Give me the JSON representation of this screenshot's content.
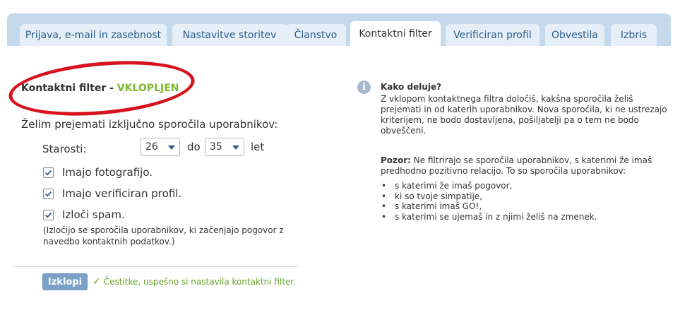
{
  "tabs": [
    {
      "label": "Prijava, e-mail in zasebnost",
      "active": false
    },
    {
      "label": "Nastavitve storitev",
      "active": false
    },
    {
      "label": "Članstvo",
      "active": false
    },
    {
      "label": "Kontaktni filter",
      "active": true
    },
    {
      "label": "Verificiran profil",
      "active": false
    },
    {
      "label": "Obvestila",
      "active": false
    },
    {
      "label": "Izbris",
      "active": false
    }
  ],
  "filter": {
    "title": "Kontaktni filter - ",
    "state": "VKLOPLJEN",
    "intro": "Želim prejemati izključno sporočila uporabnikov:",
    "age_label": "Starosti:",
    "age_from": "26",
    "age_separator": "do",
    "age_to": "35",
    "age_unit": "let",
    "options": [
      {
        "label": "Imajo fotografijo.",
        "checked": true
      },
      {
        "label": "Imajo verificiran profil.",
        "checked": true
      },
      {
        "label": "Izloči spam.",
        "checked": true
      }
    ],
    "spam_note": "(Izločijo se sporočila uporabnikov, ki začenjajo pogovor z navedbo kontaktnih podatkov.)",
    "button_label": "Izklopi",
    "success_message": "Čestitke, uspešno si nastavila kontaktni filter."
  },
  "info": {
    "icon": "info-icon",
    "heading": "Kako deluje?",
    "text": "Z vklopom kontaktnega filtra določiš, kakšna sporočila želiš prejemati in od katerih uporabnikov. Nova sporočila, ki ne ustrezajo kriterijem, ne bodo dostavljena, pošiljatelji pa o tem ne bodo obveščeni.",
    "warning_label": "Pozor:",
    "warning_text": " Ne filtrirajo se sporočila uporabnikov, s katerimi že imaš predhodno pozitivno relacijo. To so sporočila uporabnikov:",
    "bullets": [
      "s katerimi že imaš pogovor,",
      "ki so tvoje simpatije,",
      "s katerimi imaš GO!,",
      "s katerimi se ujemaš in z njimi želiš na zmenek."
    ]
  },
  "colors": {
    "tabbar": "#c5d9ed",
    "tab": "#e6eef7",
    "tab_text": "#2a5d8e",
    "accent_green": "#7cb82f",
    "oval_red": "#d7121c",
    "button": "#7ba1c9"
  }
}
